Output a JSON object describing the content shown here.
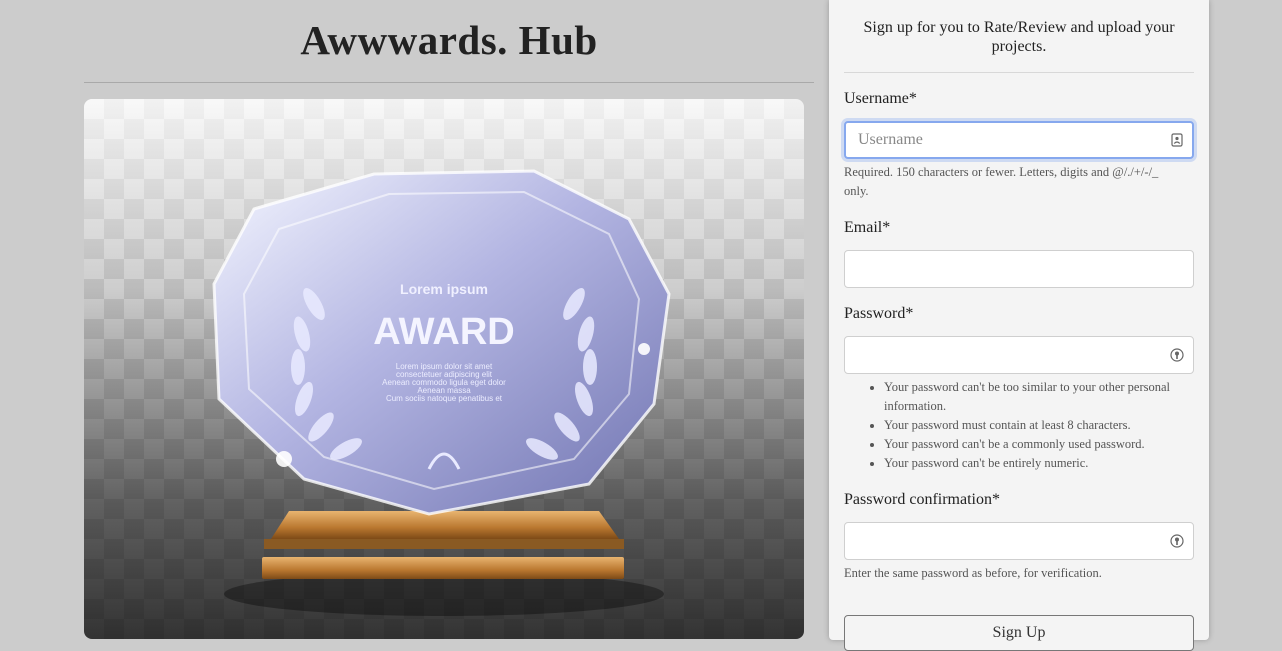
{
  "site": {
    "title": "Awwwards. Hub"
  },
  "hero": {
    "award": {
      "subtitle": "Lorem ipsum",
      "title": "AWARD",
      "body": [
        "Lorem ipsum dolor sit amet",
        "consectetuer adipiscing elit",
        "Aenean commodo ligula eget dolor",
        "Aenean massa",
        "Cum sociis natoque penatibus et"
      ]
    }
  },
  "signup": {
    "intro": "Sign up for you to Rate/Review and upload your projects.",
    "username": {
      "label": "Username*",
      "placeholder": "Username",
      "value": "",
      "help": "Required. 150 characters or fewer. Letters, digits and @/./+/-/_ only."
    },
    "email": {
      "label": "Email*",
      "value": ""
    },
    "password": {
      "label": "Password*",
      "value": "",
      "help": [
        "Your password can't be too similar to your other personal information.",
        "Your password must contain at least 8 characters.",
        "Your password can't be a commonly used password.",
        "Your password can't be entirely numeric."
      ]
    },
    "password_confirmation": {
      "label": "Password confirmation*",
      "value": "",
      "help": "Enter the same password as before, for verification."
    },
    "submit_label": "Sign Up"
  },
  "icons": {
    "username_field": "contact-card-icon",
    "password_field": "password-manager-key-icon"
  },
  "colors": {
    "background": "#cccccc",
    "panel": "#f4f4f4",
    "focus_ring": "#86a8ee"
  }
}
